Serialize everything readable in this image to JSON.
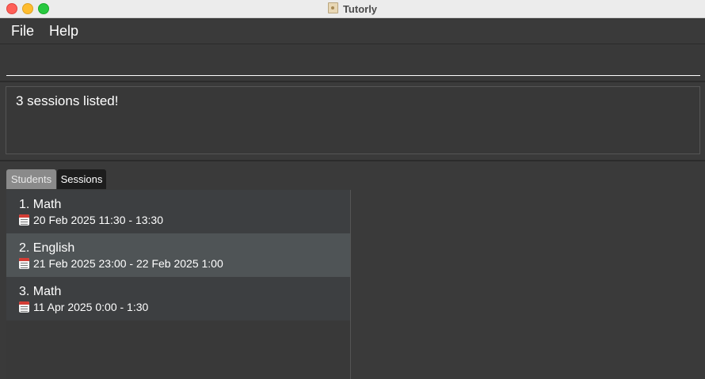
{
  "window": {
    "title": "Tutorly"
  },
  "menu": {
    "file_label": "File",
    "help_label": "Help"
  },
  "command": {
    "value": "",
    "placeholder": ""
  },
  "result": {
    "message": "3 sessions listed!"
  },
  "tabs": [
    {
      "label": "Students",
      "selected": false
    },
    {
      "label": "Sessions",
      "selected": true
    }
  ],
  "sessions": [
    {
      "index": "1.",
      "subject": "Math",
      "time": "20 Feb 2025 11:30 - 13:30"
    },
    {
      "index": "2.",
      "subject": "English",
      "time": "21 Feb 2025 23:00 - 22 Feb 2025 1:00"
    },
    {
      "index": "3.",
      "subject": "Math",
      "time": "11 Apr 2025 0:00 - 1:30"
    }
  ],
  "icons": {
    "app": "app-icon",
    "session_time": "calendar-icon"
  },
  "colors": {
    "close": "#fe5f57",
    "minimize": "#febc2e",
    "maximize": "#28c840",
    "selected_row": "#4f5456"
  }
}
